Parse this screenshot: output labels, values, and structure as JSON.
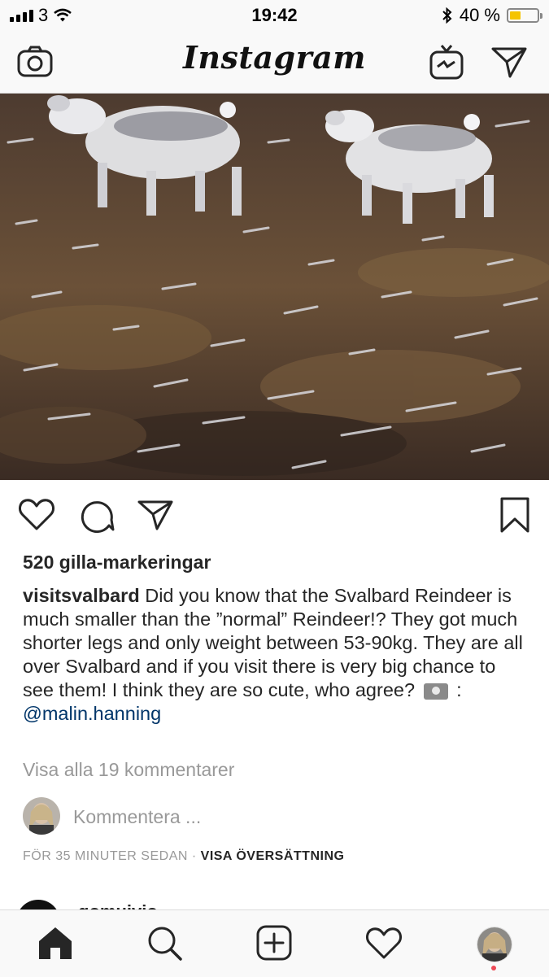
{
  "status_bar": {
    "carrier": "3",
    "time": "19:42",
    "battery_text": "40 %",
    "battery_level": 0.4
  },
  "header": {
    "title": "Instagram",
    "icons": [
      "camera-icon",
      "igtv-icon",
      "direct-message-icon"
    ]
  },
  "post": {
    "likes": "520 gilla-markeringar",
    "username": "visitsvalbard",
    "caption": " Did you know that the Svalbard Reindeer is much smaller than the ”normal” Reindeer!? They got much shorter legs and only weight between 53-90kg. They are all over Svalbard and if you visit there is very big chance to see them! I think they are so cute, who agree? ",
    "caption_after_icon": " : ",
    "mention": "@malin.hanning",
    "view_comments": "Visa alla 19 kommentarer",
    "comment_placeholder": "Kommentera ...",
    "time_ago": "FÖR 35 MINUTER SEDAN",
    "separator": " · ",
    "translate": "VISA ÖVERSÄTTNING"
  },
  "next_post": {
    "username": "gomuivio"
  },
  "tabbar": {
    "items": [
      "home-icon",
      "search-icon",
      "add-post-icon",
      "activity-heart-icon",
      "profile-avatar"
    ]
  },
  "colors": {
    "accent_mention": "#003569",
    "battery": "#f5c400",
    "notification": "#ed4956"
  }
}
